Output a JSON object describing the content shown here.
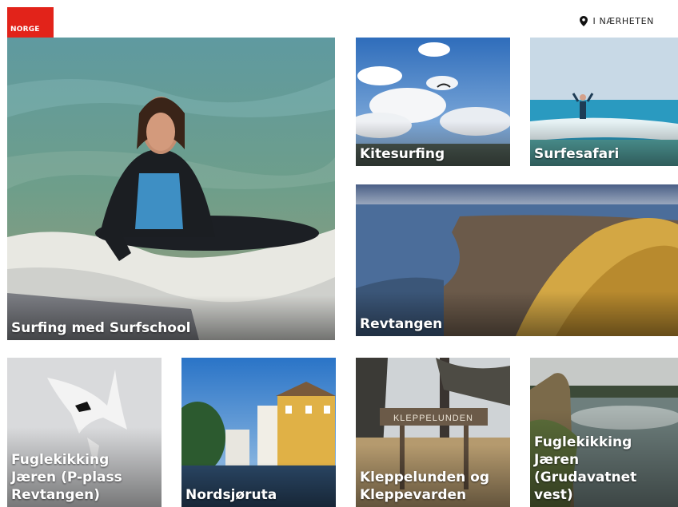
{
  "header": {
    "logo_text": "NORGE",
    "nearby_label": "I NÆRHETEN",
    "nearby_icon": "map-pin-icon",
    "brand_color": "#e2231a"
  },
  "tiles": [
    {
      "label": "Surfing med Surfschool"
    },
    {
      "label": "Kitesurfing"
    },
    {
      "label": "Surfesafari"
    },
    {
      "label": "Revtangen"
    },
    {
      "label": "Fuglekikking Jæren (P-plass Revtangen)"
    },
    {
      "label": "Nordsjøruta"
    },
    {
      "label": "Kleppelunden og Kleppevarden"
    },
    {
      "label": "Fuglekikking Jæren (Grudavatnet vest)"
    }
  ],
  "sign_text": "KLEPPELUNDEN"
}
